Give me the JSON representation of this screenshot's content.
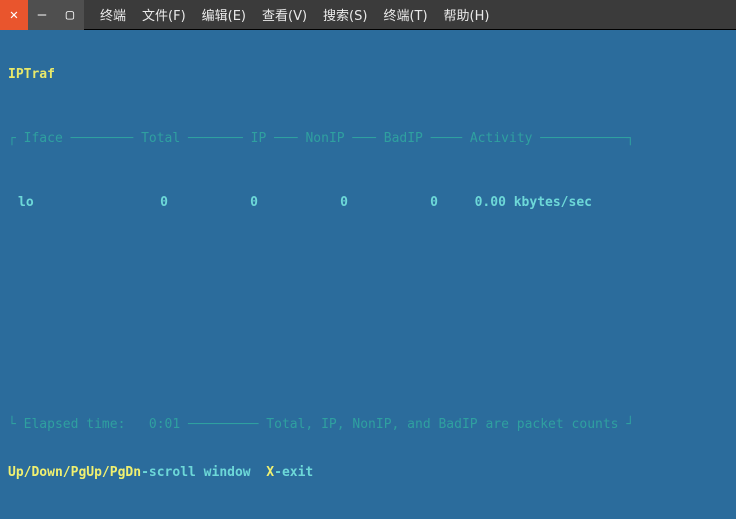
{
  "titlebar": {
    "menu": [
      "终端",
      "文件(F)",
      "编辑(E)",
      "查看(V)",
      "搜索(S)",
      "终端(T)",
      "帮助(H)"
    ]
  },
  "app": {
    "title": "IPTraf"
  },
  "columns": {
    "iface": "Iface",
    "total": "Total",
    "ip": "IP",
    "nonip": "NonIP",
    "badip": "BadIP",
    "activity": "Activity"
  },
  "rows": [
    {
      "iface": "lo",
      "total": "0",
      "ip": "0",
      "nonip": "0",
      "badip": "0",
      "activity": "0.00 kbytes/sec"
    }
  ],
  "footer": {
    "elapsed_label": "Elapsed time:",
    "elapsed_value": "0:01",
    "note": "Total, IP, NonIP, and BadIP are packet counts",
    "hint_keys": "Up/Down/PgUp/PgDn",
    "hint_scroll": "-scroll window",
    "hint_x": "X",
    "hint_exit": "-exit"
  }
}
